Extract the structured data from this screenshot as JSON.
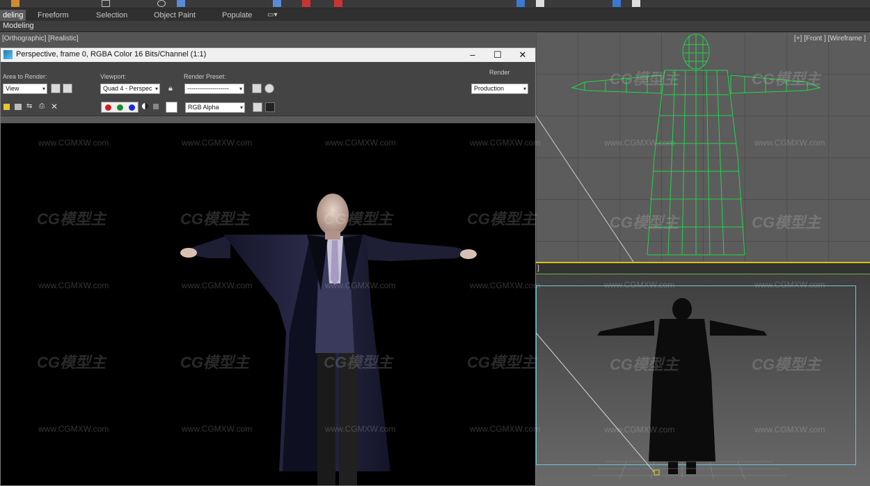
{
  "ribbon": {
    "tabs": [
      "deling",
      "Freeform",
      "Selection",
      "Object Paint",
      "Populate"
    ],
    "active_tab": "deling",
    "sub_label": "Modeling"
  },
  "viewports": {
    "top_left_label": "[Orthographic] [Realistic]",
    "front_label": "[+] [Front ] [Wireframe ]",
    "persp_label": "]"
  },
  "render_window": {
    "title": "Perspective, frame 0, RGBA Color 16 Bits/Channel (1:1)",
    "area_to_render_label": "Area to Render:",
    "area_to_render_value": "View",
    "viewport_label": "Viewport:",
    "viewport_value": "Quad 4 - Perspec",
    "render_preset_label": "Render Preset:",
    "render_preset_value": "--------------------",
    "render_label": "Render",
    "render_value": "Production",
    "channel_value": "RGB Alpha",
    "minimize_label": "–",
    "maximize_label": "☐",
    "close_label": "✕"
  },
  "watermarks": {
    "url": "www.CGMXW.com",
    "logo": "CG模型主"
  },
  "colors": {
    "wireframe": "#22d64a",
    "persp_frame": "#68c8d8",
    "active_border": "#d9c400"
  }
}
